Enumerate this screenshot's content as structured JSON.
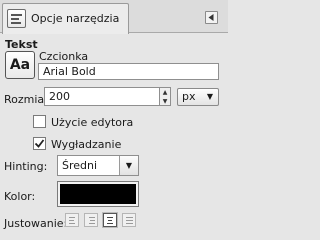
{
  "tabs": {
    "active_label": "Opcje narzędzia",
    "menu_icon": "triangle-left-icon"
  },
  "text_tool": {
    "heading": "Tekst",
    "font_preview": "Aa",
    "font_label": "Czcionka",
    "font_value": "Arial Bold",
    "size_label": "Rozmiar:",
    "size_value": "200",
    "size_unit": "px",
    "use_editor_label": "Użycie edytora",
    "use_editor_checked": false,
    "antialias_label": "Wygładzanie",
    "antialias_checked": true,
    "hinting_label": "Hinting:",
    "hinting_value": "Średni",
    "color_label": "Kolor:",
    "color_value": "#000000",
    "justify_label": "Justowanie:",
    "justify_options": [
      "left",
      "right",
      "center",
      "fill"
    ],
    "justify_selected": "center"
  }
}
